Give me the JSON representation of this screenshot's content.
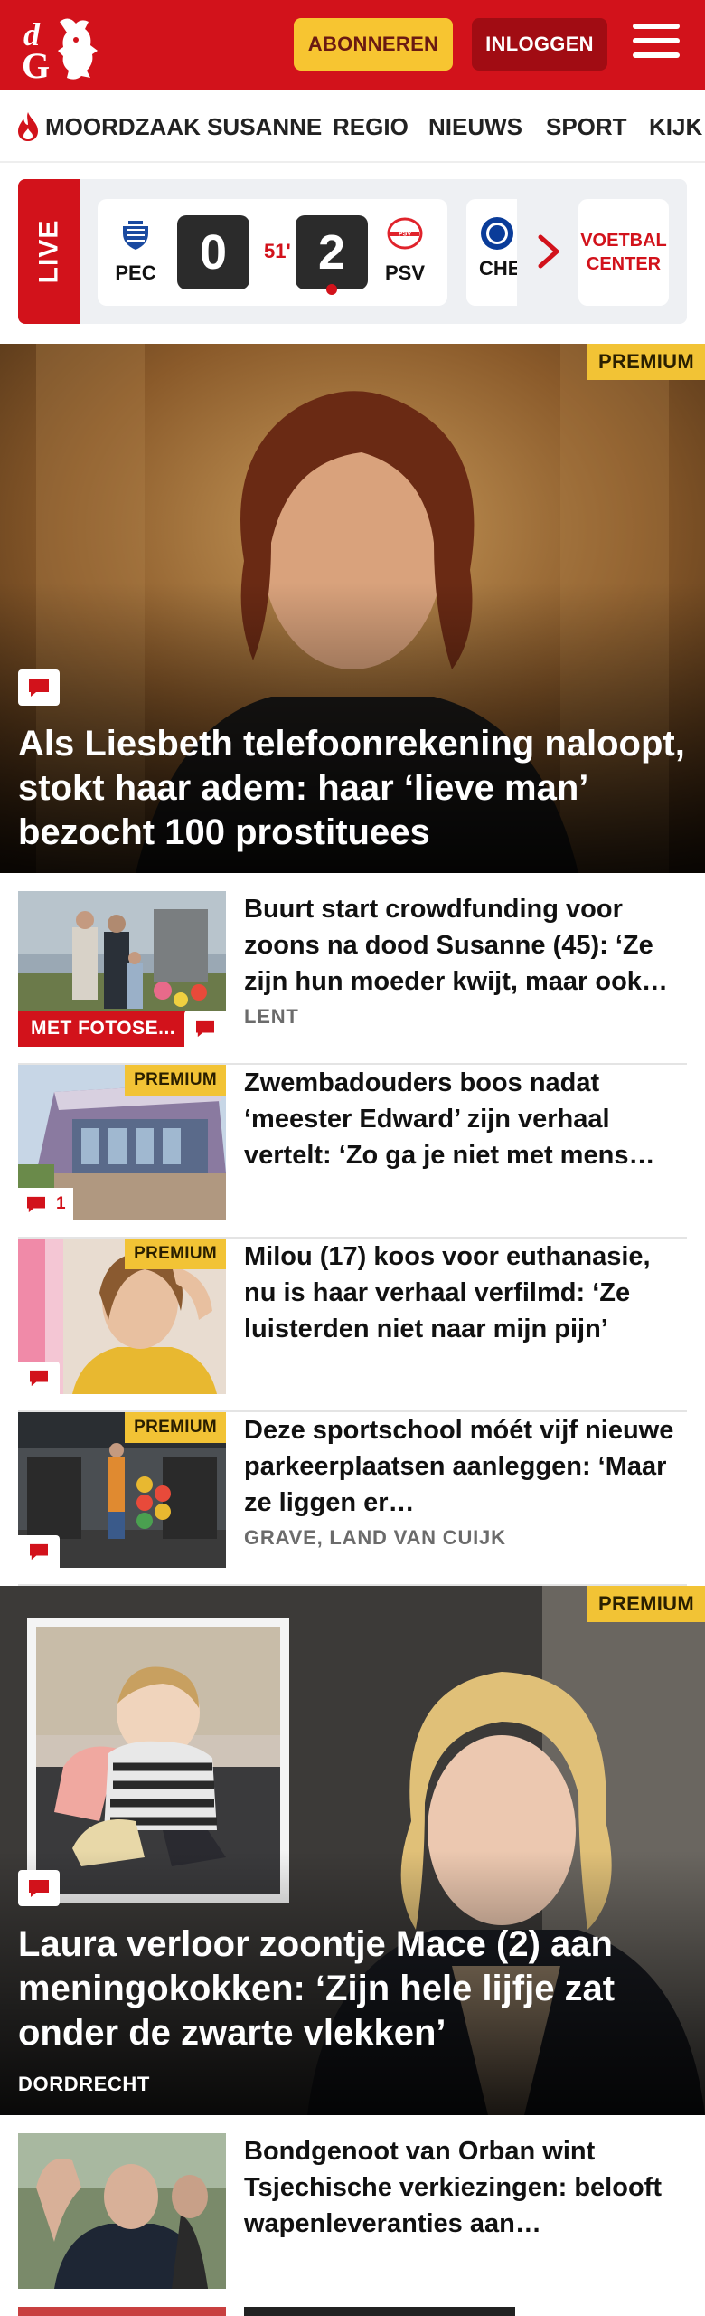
{
  "header": {
    "subscribe_label": "ABONNEREN",
    "login_label": "INLOGGEN"
  },
  "nav": {
    "items": [
      "MOORDZAAK SUSANNE",
      "REGIO",
      "NIEUWS",
      "SPORT",
      "KIJK"
    ]
  },
  "live": {
    "label": "LIVE",
    "match": {
      "home": "PEC",
      "away": "PSV",
      "home_score": "0",
      "away_score": "2",
      "minute": "51'"
    },
    "next_match_team": "CHE",
    "football_center_label": "VOETBAL CENTER"
  },
  "hero1": {
    "badge": "PREMIUM",
    "title": "Als Liesbeth telefoonrekening naloopt, stokt haar adem: haar ‘lieve man’ bezocht 100 prostituees"
  },
  "articles": [
    {
      "title": "Buurt start crowdfunding voor zoons na dood Susanne (45): ‘Ze zijn hun moeder kwijt, maar ook…",
      "location": "LENT",
      "photo_badge": "MET FOTOSE..."
    },
    {
      "title": "Zwembadouders boos nadat ‘meester Edward’ zijn verhaal vertelt: ‘Zo ga je niet met mens…",
      "badge": "PREMIUM",
      "comments": "1"
    },
    {
      "title": "Milou (17) koos voor euthanasie, nu is haar verhaal verfilmd: ‘Ze luisterden niet naar mijn pijn’",
      "badge": "PREMIUM"
    },
    {
      "title": "Deze sportschool móét vijf nieuwe parkeerplaatsen aanleggen: ‘Maar ze liggen er…",
      "location": "GRAVE, LAND VAN CUIJK",
      "badge": "PREMIUM"
    }
  ],
  "hero2": {
    "badge": "PREMIUM",
    "title": "Laura verloor zoontje Mace (2) aan meningokokken: ‘Zijn hele lijfje zat onder de zwarte vlekken’",
    "location": "DORDRECHT"
  },
  "article_last": {
    "title": "Bondgenoot van Orban wint Tsjechische verkiezingen: belooft wapenleveranties aan…"
  },
  "colors": {
    "brand_red": "#d2121b",
    "premium_yellow": "#f2c335",
    "subscribe_yellow": "#f7c531"
  }
}
